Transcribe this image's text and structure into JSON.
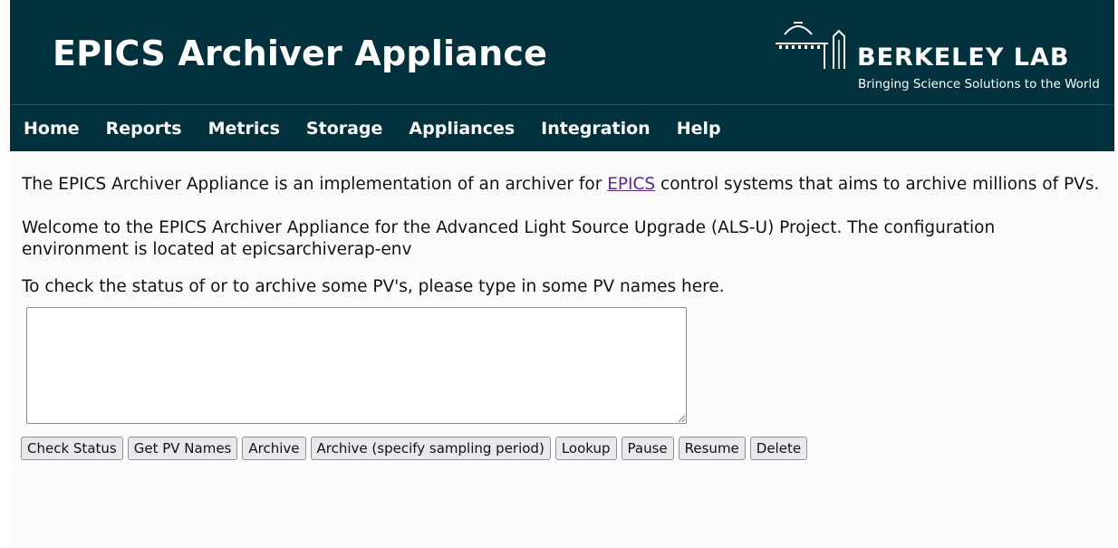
{
  "header": {
    "title": "EPICS Archiver Appliance",
    "logo": {
      "name": "BERKELEY LAB",
      "tagline": "Bringing Science Solutions to the World"
    }
  },
  "nav": {
    "items": [
      "Home",
      "Reports",
      "Metrics",
      "Storage",
      "Appliances",
      "Integration",
      "Help"
    ]
  },
  "main": {
    "intro_before_link": "The EPICS Archiver Appliance is an implementation of an archiver for ",
    "intro_link": "EPICS",
    "intro_after_link": " control systems that aims to archive millions of PVs.",
    "welcome": "Welcome to the EPICS Archiver Appliance for the Advanced Light Source Upgrade (ALS-U) Project. The configuration environment is located at epicsarchiverap-env",
    "instructions": "To check the status of or to archive some PV's, please type in some PV names here.",
    "pv_input_value": ""
  },
  "actions": {
    "check_status": "Check Status",
    "get_pv_names": "Get PV Names",
    "archive": "Archive",
    "archive_specify": "Archive (specify sampling period)",
    "lookup": "Lookup",
    "pause": "Pause",
    "resume": "Resume",
    "delete": "Delete"
  },
  "colors": {
    "header_bg": "#00313c",
    "link": "#5a2a8c"
  }
}
